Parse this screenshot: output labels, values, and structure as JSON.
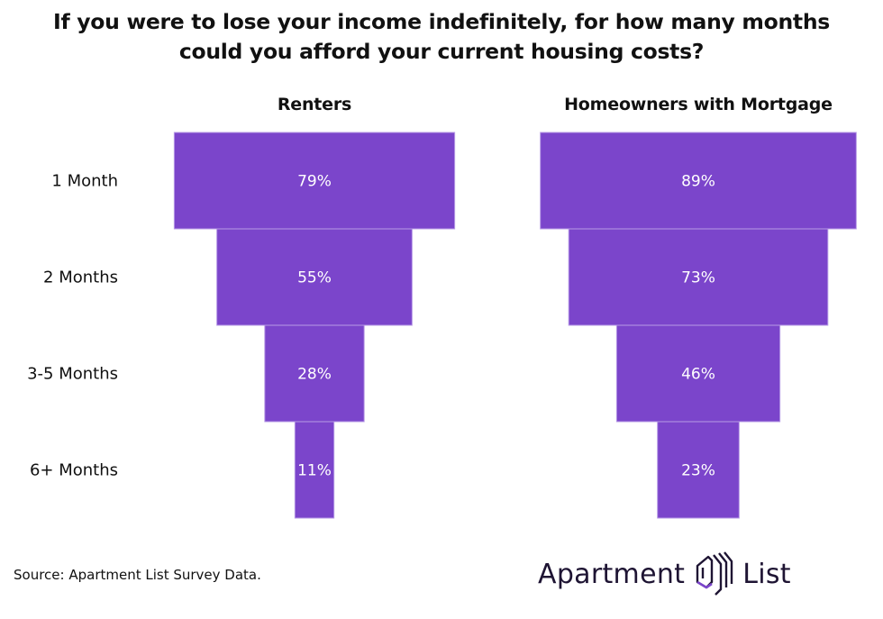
{
  "title_lines": [
    "If you were to lose your income indefinitely, for how many months",
    "could you afford your current housing costs?"
  ],
  "colors": {
    "bar": "#7b45cb",
    "bar_border": "#b79ae6",
    "bar_text": "#ffffff",
    "logo_text": "#1e1433",
    "logo_accent": "#7b45cb"
  },
  "chart_data": {
    "type": "bar",
    "subtype": "funnel",
    "title": "If you were to lose your income indefinitely, for how many months could you afford your current housing costs?",
    "categories": [
      "1 Month",
      "2 Months",
      "3-5 Months",
      "6+ Months"
    ],
    "series": [
      {
        "name": "Renters",
        "values": [
          79,
          55,
          28,
          11
        ],
        "labels": [
          "79%",
          "55%",
          "28%",
          "11%"
        ]
      },
      {
        "name": "Homeowners with Mortgage",
        "values": [
          89,
          73,
          46,
          23
        ],
        "labels": [
          "89%",
          "73%",
          "46%",
          "23%"
        ]
      }
    ],
    "unit": "%",
    "xlabel": "",
    "ylabel": "",
    "grid": false,
    "legend": "none"
  },
  "footer": {
    "source": "Source: Apartment List Survey Data.",
    "logo": {
      "word1": "Apartment",
      "word2": "List",
      "icon": "apartment-list-house-icon"
    }
  }
}
